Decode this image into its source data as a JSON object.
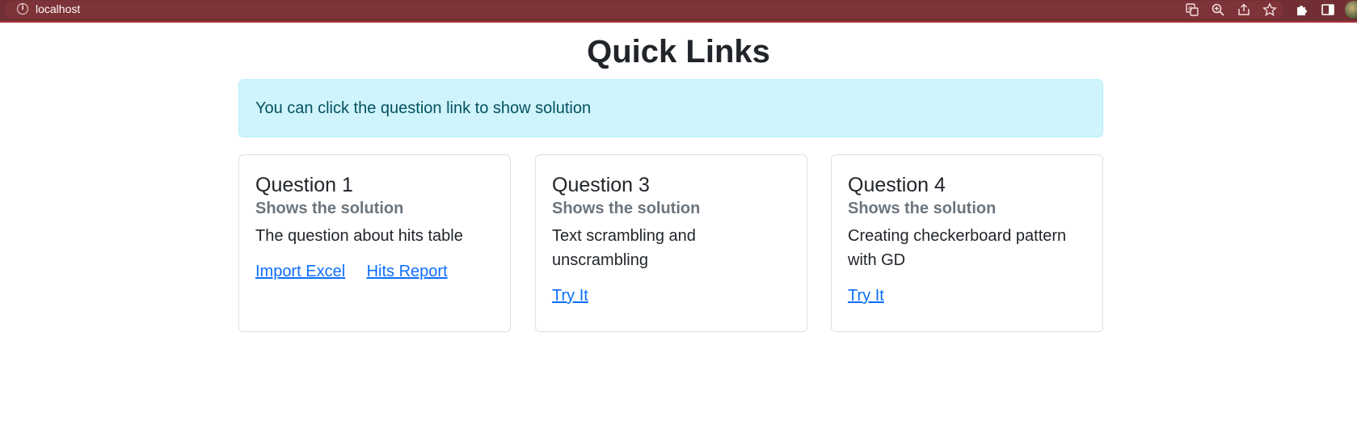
{
  "browser": {
    "url": "localhost",
    "icons": [
      "info-icon",
      "translate-icon",
      "zoom-icon",
      "share-icon",
      "bookmark-star-icon",
      "extensions-icon",
      "side-panel-icon",
      "profile-avatar"
    ]
  },
  "page": {
    "title": "Quick Links",
    "alert": "You can click the question link to show solution"
  },
  "cards": [
    {
      "title": "Question 1",
      "subtitle": "Shows the solution",
      "text": "The question about hits table",
      "links": [
        "Import Excel",
        "Hits Report"
      ]
    },
    {
      "title": "Question 3",
      "subtitle": "Shows the solution",
      "text": "Text scrambling and unscrambling",
      "links": [
        "Try It"
      ]
    },
    {
      "title": "Question 4",
      "subtitle": "Shows the solution",
      "text": "Creating checkerboard pattern with GD",
      "links": [
        "Try It"
      ]
    }
  ],
  "colors": {
    "browser_bar": "#722f33",
    "alert_bg": "#cff4fc",
    "alert_text": "#055160",
    "link": "#0d6efd",
    "subtitle": "#6c757d"
  }
}
